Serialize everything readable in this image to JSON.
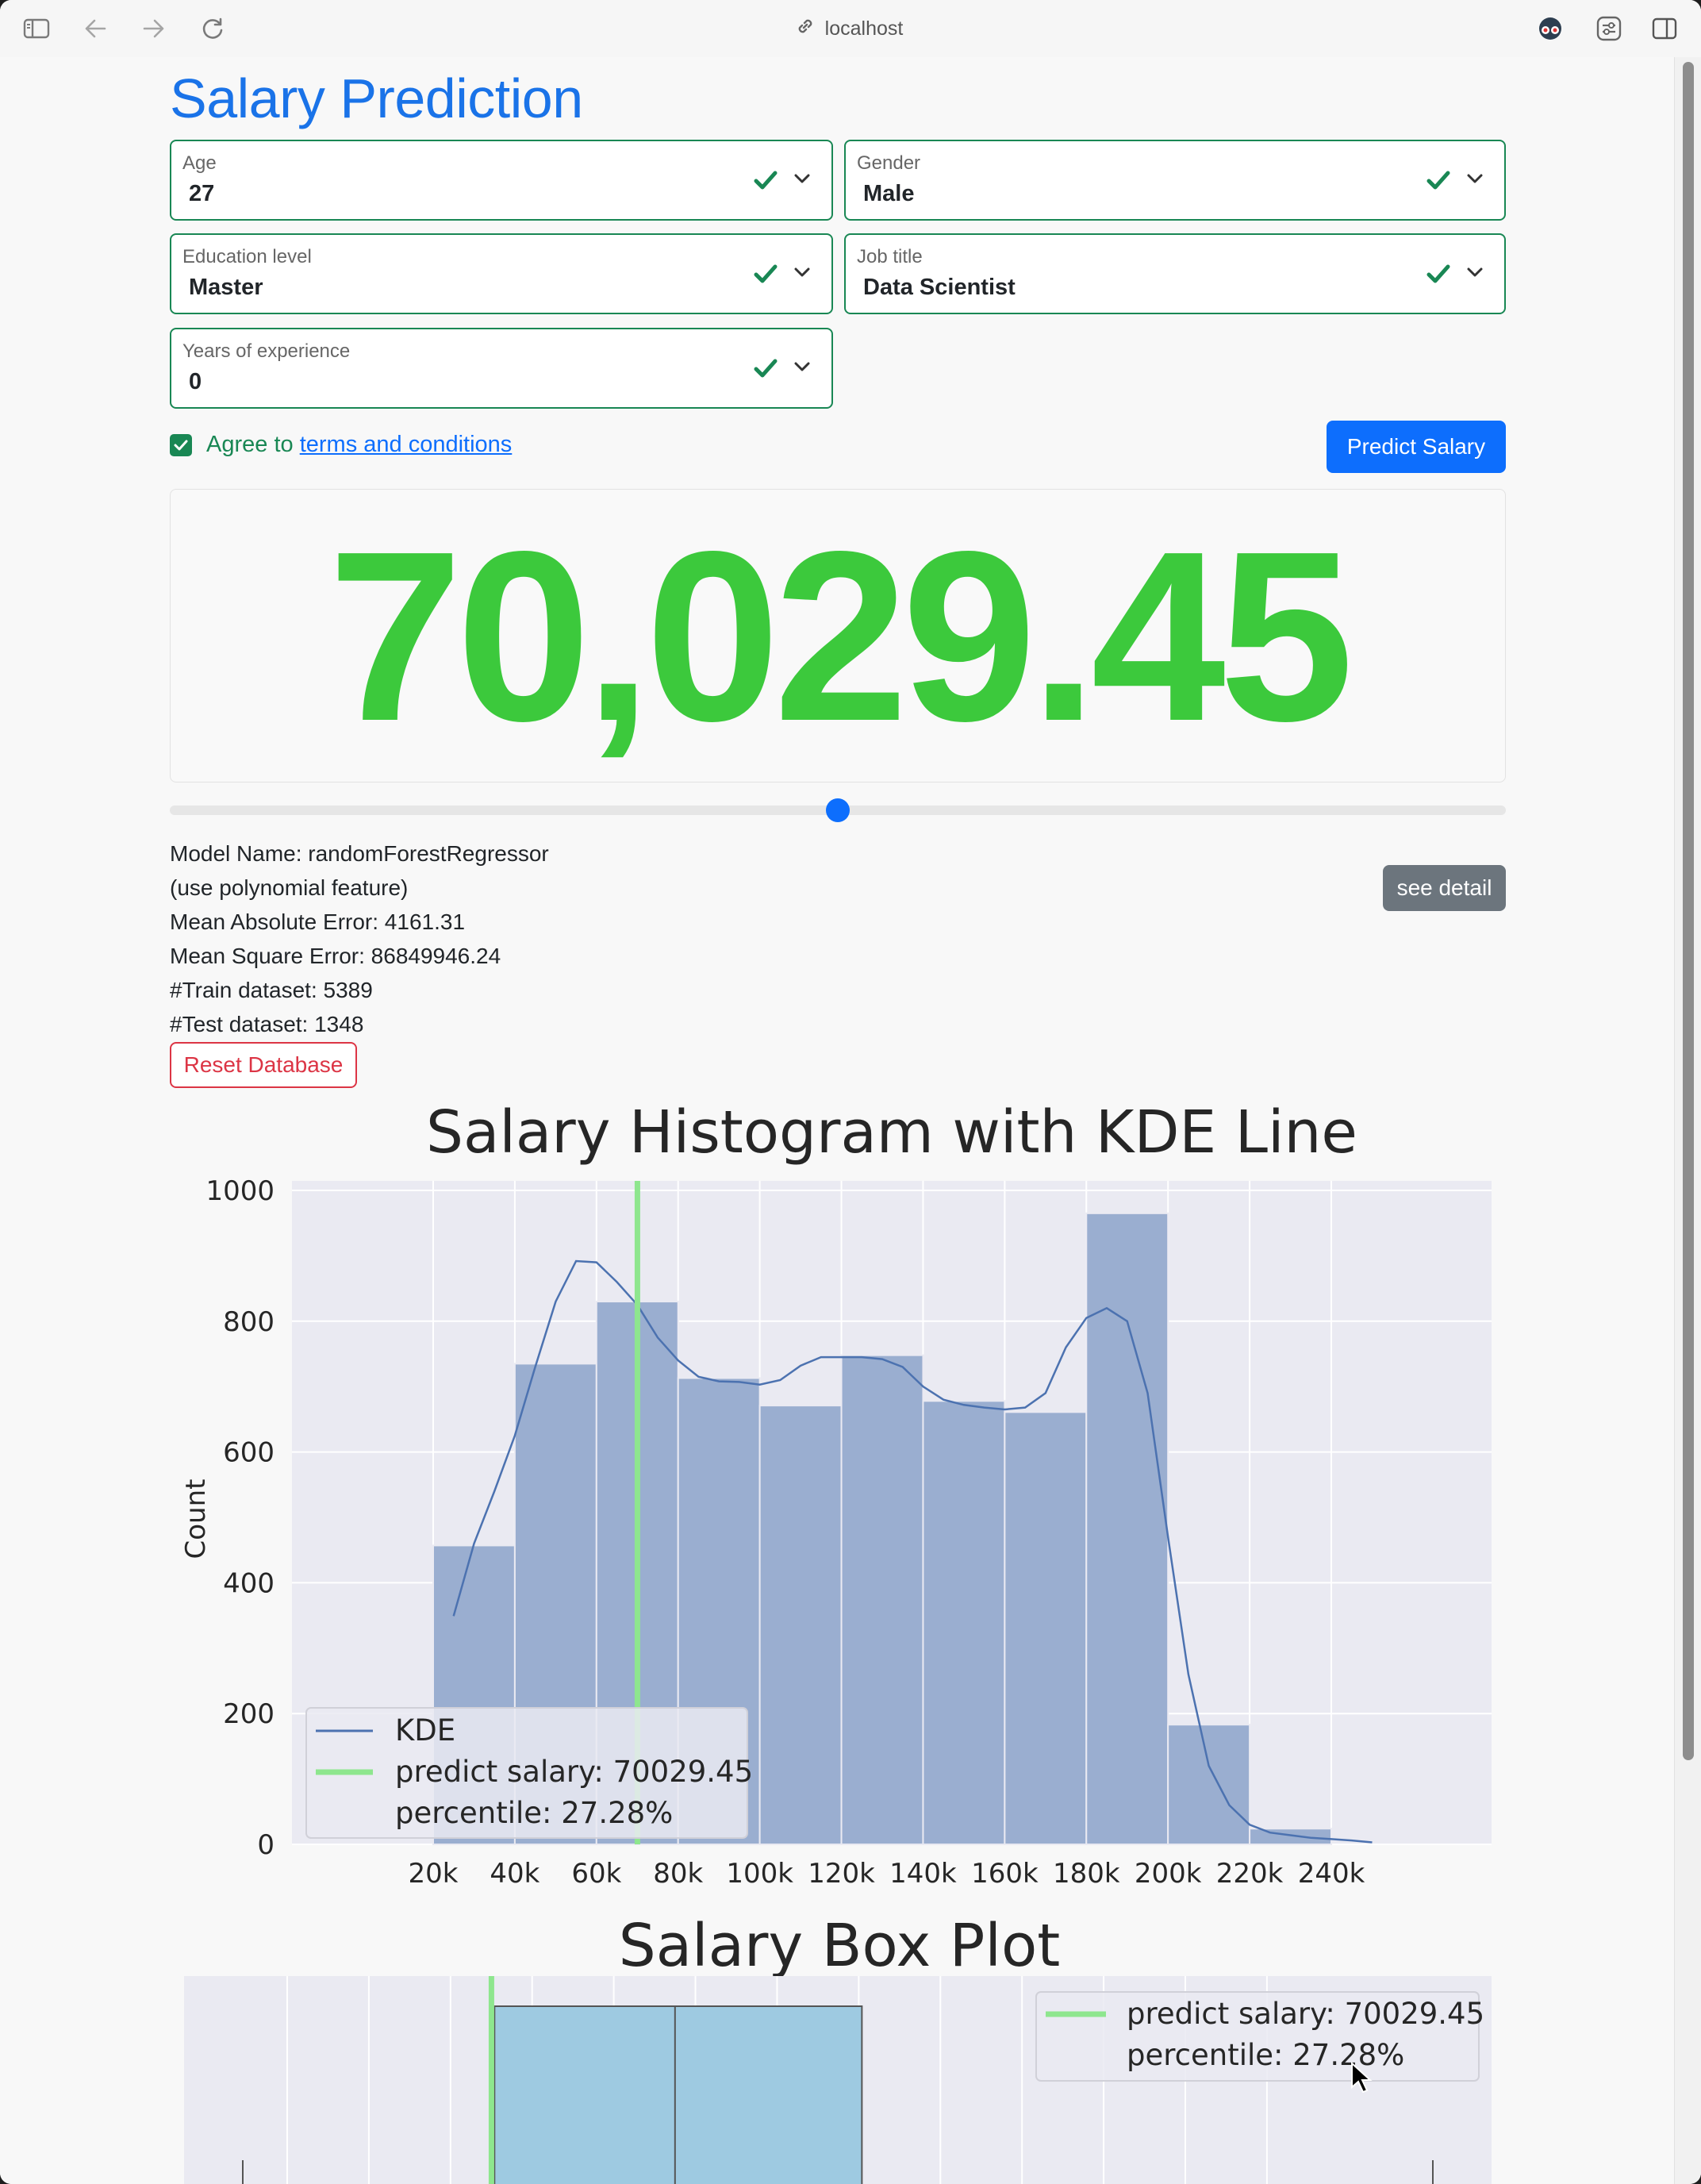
{
  "browser": {
    "address": "localhost"
  },
  "page": {
    "title": "Salary Prediction",
    "fields": [
      {
        "label": "Age",
        "value": "27"
      },
      {
        "label": "Gender",
        "value": "Male"
      },
      {
        "label": "Education level",
        "value": "Master"
      },
      {
        "label": "Job title",
        "value": "Data Scientist"
      },
      {
        "label": "Years of experience",
        "value": "0"
      }
    ],
    "agree_prefix": "Agree to",
    "agree_link": "terms and conditions",
    "predict_button": "Predict Salary",
    "result": "70,029.45",
    "slider_value": 0.5,
    "model_info": [
      "Model Name: randomForestRegressor",
      "(use polynomial feature)",
      "Mean Absolute Error: 4161.31",
      "Mean Square Error: 86849946.24",
      "#Train dataset: 5389",
      "#Test dataset: 1348"
    ],
    "see_detail_button": "see detail",
    "reset_button": "Reset Database"
  },
  "colors": {
    "accent": "#0d6efd",
    "success": "#198754",
    "result": "#3cc93c",
    "danger": "#dc3545",
    "secondary": "#6c757d",
    "bars": "#9aaed0",
    "kde": "#4c72b0",
    "predict_line": "#8ee68e",
    "box": "#9ecae1"
  },
  "chart_data": [
    {
      "type": "bar",
      "title": "Salary Histogram with KDE Line",
      "xlabel": "",
      "ylabel": "Count",
      "x_ticks": [
        "20k",
        "40k",
        "60k",
        "80k",
        "100k",
        "120k",
        "140k",
        "160k",
        "180k",
        "200k",
        "220k",
        "240k"
      ],
      "xlim": [
        20000,
        240000
      ],
      "ylim": [
        0,
        1000
      ],
      "y_ticks": [
        "0",
        "200",
        "400",
        "600",
        "800",
        "1000"
      ],
      "bins": [
        20000,
        40000,
        60000,
        80000,
        100000,
        120000,
        140000,
        160000,
        180000,
        200000,
        220000,
        240000
      ],
      "values": [
        457,
        735,
        830,
        713,
        671,
        748,
        678,
        661,
        965,
        183,
        24
      ],
      "kde": {
        "name": "KDE",
        "x": [
          25000,
          30000,
          35000,
          40000,
          45000,
          50000,
          55000,
          60000,
          65000,
          70000,
          75000,
          80000,
          85000,
          90000,
          95000,
          100000,
          105000,
          110000,
          115000,
          120000,
          125000,
          130000,
          135000,
          140000,
          145000,
          150000,
          155000,
          160000,
          165000,
          170000,
          175000,
          180000,
          185000,
          190000,
          195000,
          200000,
          205000,
          210000,
          215000,
          220000,
          225000,
          230000,
          235000,
          240000,
          245000,
          250000
        ],
        "y": [
          349,
          460,
          540,
          625,
          730,
          830,
          892,
          890,
          860,
          825,
          775,
          740,
          715,
          708,
          707,
          703,
          710,
          732,
          745,
          745,
          745,
          742,
          730,
          700,
          680,
          672,
          668,
          665,
          668,
          690,
          760,
          805,
          820,
          800,
          690,
          470,
          260,
          120,
          60,
          30,
          18,
          14,
          10,
          8,
          6,
          3
        ]
      },
      "predict_salary": 70029.45,
      "legend": [
        "KDE",
        "predict salary: 70029.45",
        "percentile: 27.28%"
      ],
      "legend_position": "lower-left",
      "grid": true
    },
    {
      "type": "box",
      "title": "Salary Box Plot",
      "q1": 70000,
      "median": 115000,
      "q3": 160000,
      "predict_salary": 70029.45,
      "legend": [
        "predict salary: 70029.45",
        "percentile: 27.28%"
      ],
      "legend_position": "top-right",
      "grid": true
    }
  ]
}
